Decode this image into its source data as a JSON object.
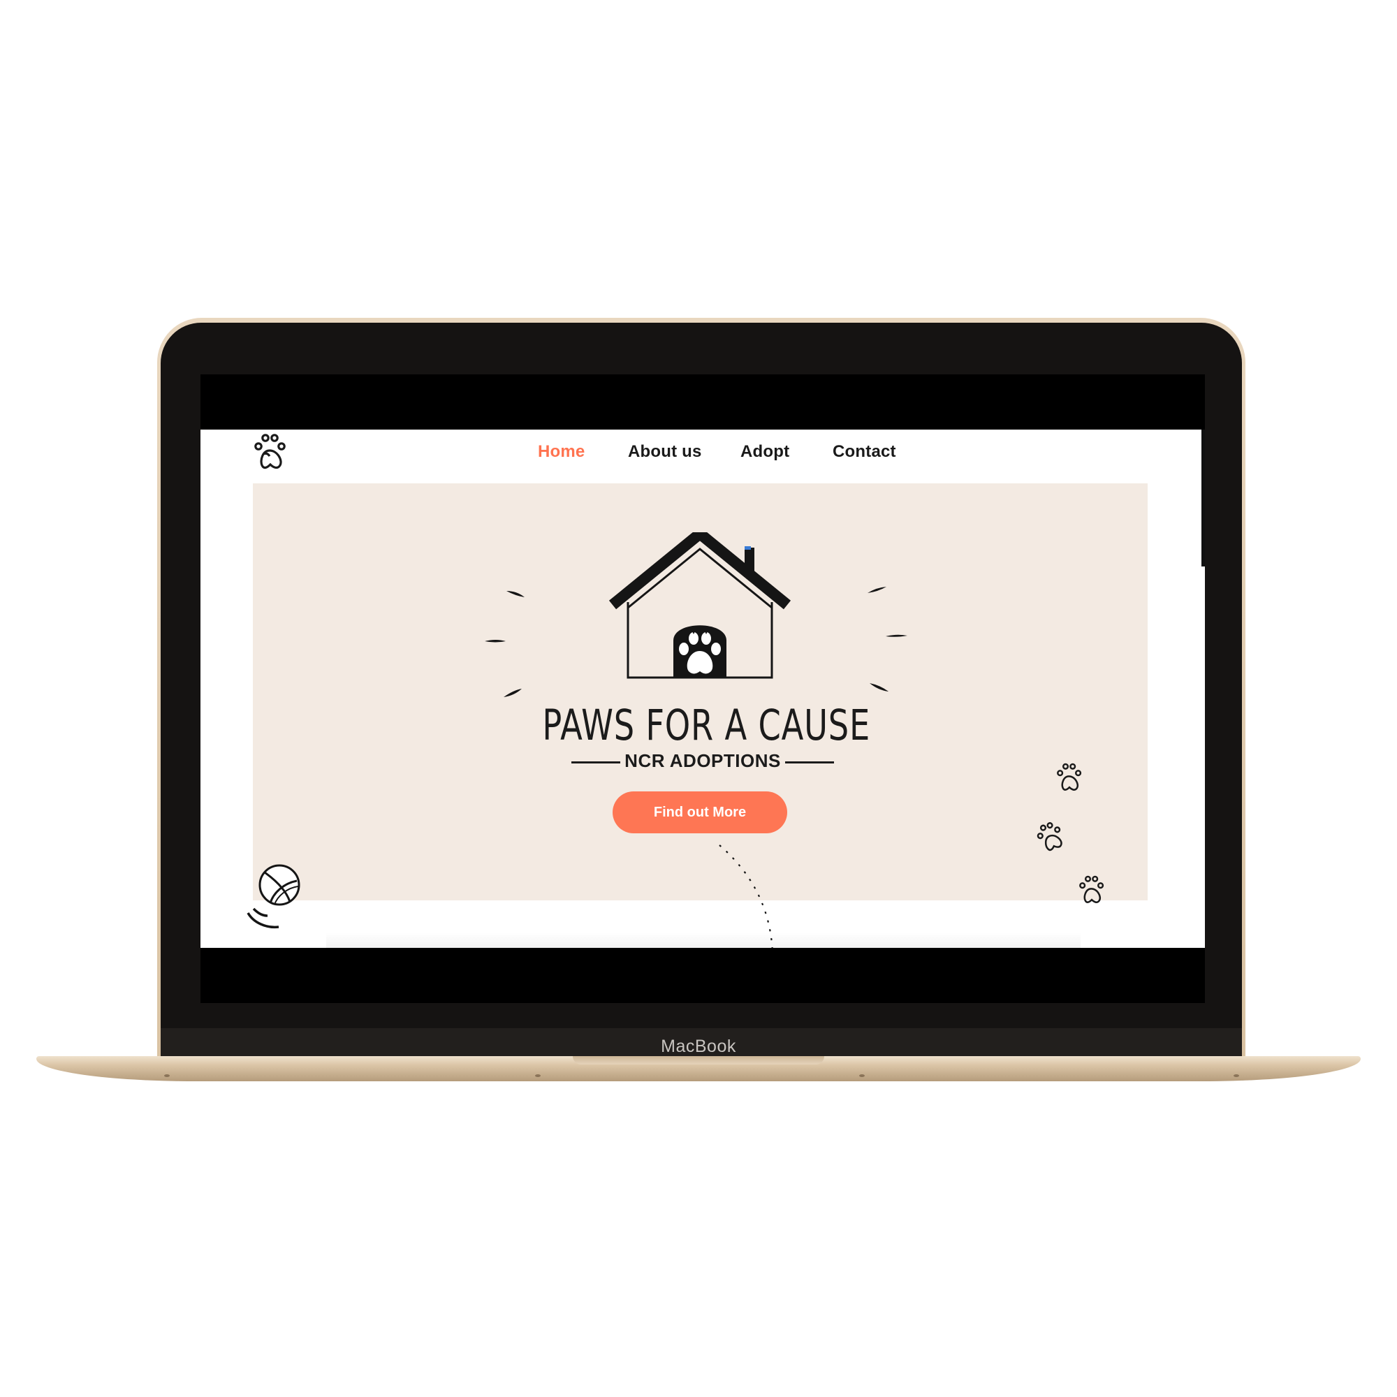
{
  "device": {
    "brand_label": "MacBook"
  },
  "site": {
    "nav": [
      {
        "label": "Home",
        "active": true
      },
      {
        "label": "About us",
        "active": false
      },
      {
        "label": "Adopt",
        "active": false
      },
      {
        "label": "Contact",
        "active": false
      }
    ],
    "hero": {
      "title": "PAWS FOR A CAUSE",
      "subtitle": "NCR ADOPTIONS",
      "cta_label": "Find out More"
    }
  },
  "colors": {
    "accent": "#ff7350",
    "hero_bg": "#f3eae2",
    "text": "#1a1a1a"
  },
  "icons": [
    "paw-logo-icon",
    "house-paw-logo",
    "yarn-ball-icon",
    "paw-print-icon"
  ]
}
